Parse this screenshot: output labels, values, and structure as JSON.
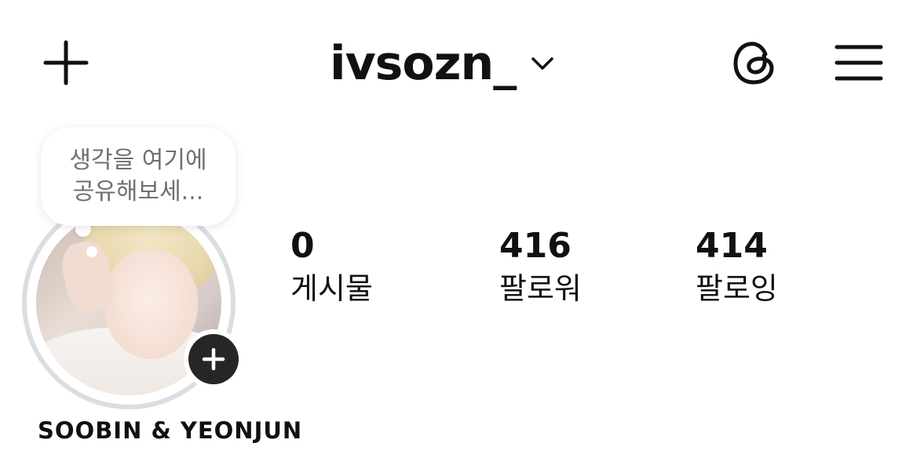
{
  "header": {
    "username": "ivsozn_",
    "icons": {
      "add": "plus-icon",
      "account_switcher": "chevron-down-icon",
      "threads": "threads-icon",
      "menu": "hamburger-menu-icon"
    }
  },
  "profile": {
    "note_bubble": {
      "line1": "생각을 여기에",
      "line2": "공유해보세..."
    },
    "avatar": "profile-photo",
    "add_story_icon": "plus-icon",
    "display_name": "SOOBIN & YEONJUN"
  },
  "stats": [
    {
      "value": "0",
      "label": "게시물"
    },
    {
      "value": "416",
      "label": "팔로워"
    },
    {
      "value": "414",
      "label": "팔로잉"
    }
  ],
  "colors": {
    "text": "#111111",
    "bubble_text": "#6f6f6f",
    "ring": "#dcdde2",
    "badge": "#262626"
  }
}
